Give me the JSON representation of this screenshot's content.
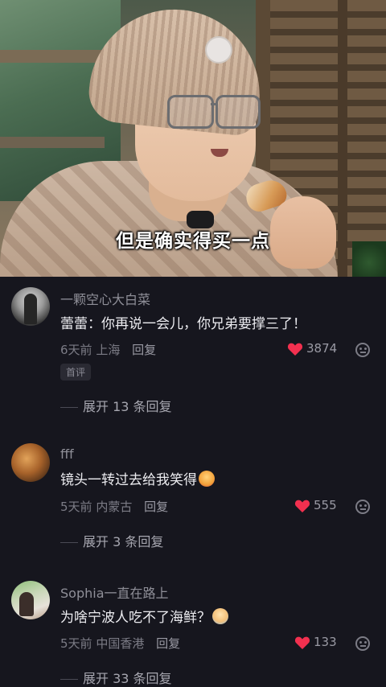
{
  "video": {
    "subtitle": "但是确实得买一点"
  },
  "comments": [
    {
      "username": "一颗空心大白菜",
      "text": "蕾蕾：你再说一会儿，你兄弟要撑三了！",
      "time": "6天前",
      "location": "上海",
      "reply_label": "回复",
      "likes": "3874",
      "tag": "首评",
      "expand": "展开 13 条回复"
    },
    {
      "username": "fff",
      "text": "镜头一转过去给我笑得",
      "time": "5天前",
      "location": "内蒙古",
      "reply_label": "回复",
      "likes": "555",
      "expand": "展开 3 条回复"
    },
    {
      "username": "Sophia一直在路上",
      "text": "为啥宁波人吃不了海鲜？",
      "time": "5天前",
      "location": "中国香港",
      "reply_label": "回复",
      "likes": "133",
      "expand": "展开 33 条回复"
    }
  ],
  "colors": {
    "background": "#16161e",
    "like_heart": "#f2304f",
    "text_primary": "#ececf0",
    "text_secondary": "#7c7c86"
  },
  "icons": {
    "like": "heart-icon",
    "dislike": "dislike-face-icon"
  }
}
